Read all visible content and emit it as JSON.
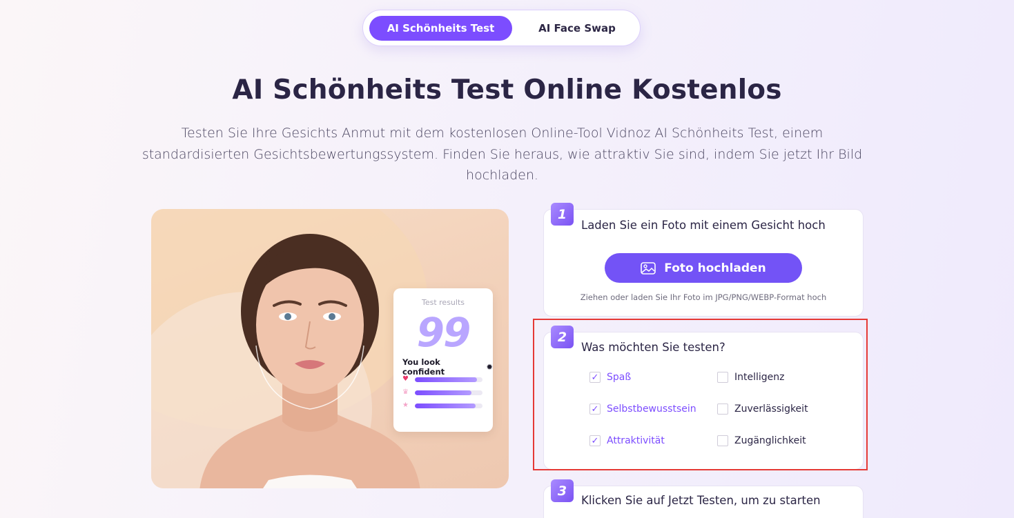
{
  "tabs": [
    {
      "label": "AI Schönheits Test",
      "active": true
    },
    {
      "label": "AI Face Swap",
      "active": false
    }
  ],
  "title": "AI Schönheits Test Online Kostenlos",
  "subtitle": "Testen Sie Ihre Gesichts Anmut mit dem kostenlosen Online-Tool Vidnoz AI Schönheits Test, einem standardisierten Gesichtsbewertungssystem. Finden Sie heraus, wie attraktiv Sie sind, indem Sie jetzt Ihr Bild hochladen.",
  "result_card": {
    "label": "Test results",
    "score": "99",
    "confident_text": "You look confident",
    "bars": [
      {
        "icon": "heart-icon",
        "color": "#e8386b",
        "fill": 0.92
      },
      {
        "icon": "crown-icon",
        "color": "#f4a3c8",
        "fill": 0.84
      },
      {
        "icon": "star-icon",
        "color": "#f4a3c8",
        "fill": 0.9
      }
    ]
  },
  "steps": [
    {
      "number": "1",
      "title": "Laden Sie ein Foto mit einem Gesicht hoch",
      "button_label": "Foto hochladen",
      "hint": "Ziehen oder laden Sie Ihr Foto im JPG/PNG/WEBP-Format hoch"
    },
    {
      "number": "2",
      "title": "Was möchten Sie testen?",
      "options": [
        {
          "label": "Spaß",
          "checked": true
        },
        {
          "label": "Intelligenz",
          "checked": false
        },
        {
          "label": "Selbstbewusstsein",
          "checked": true
        },
        {
          "label": "Zuverlässigkeit",
          "checked": false
        },
        {
          "label": "Attraktivität",
          "checked": true
        },
        {
          "label": "Zugänglichkeit",
          "checked": false
        }
      ]
    },
    {
      "number": "3",
      "title": "Klicken Sie auf Jetzt Testen, um zu starten"
    }
  ],
  "colors": {
    "accent": "#7c4dff",
    "button": "#7353f6",
    "highlight_border": "#e53935"
  }
}
